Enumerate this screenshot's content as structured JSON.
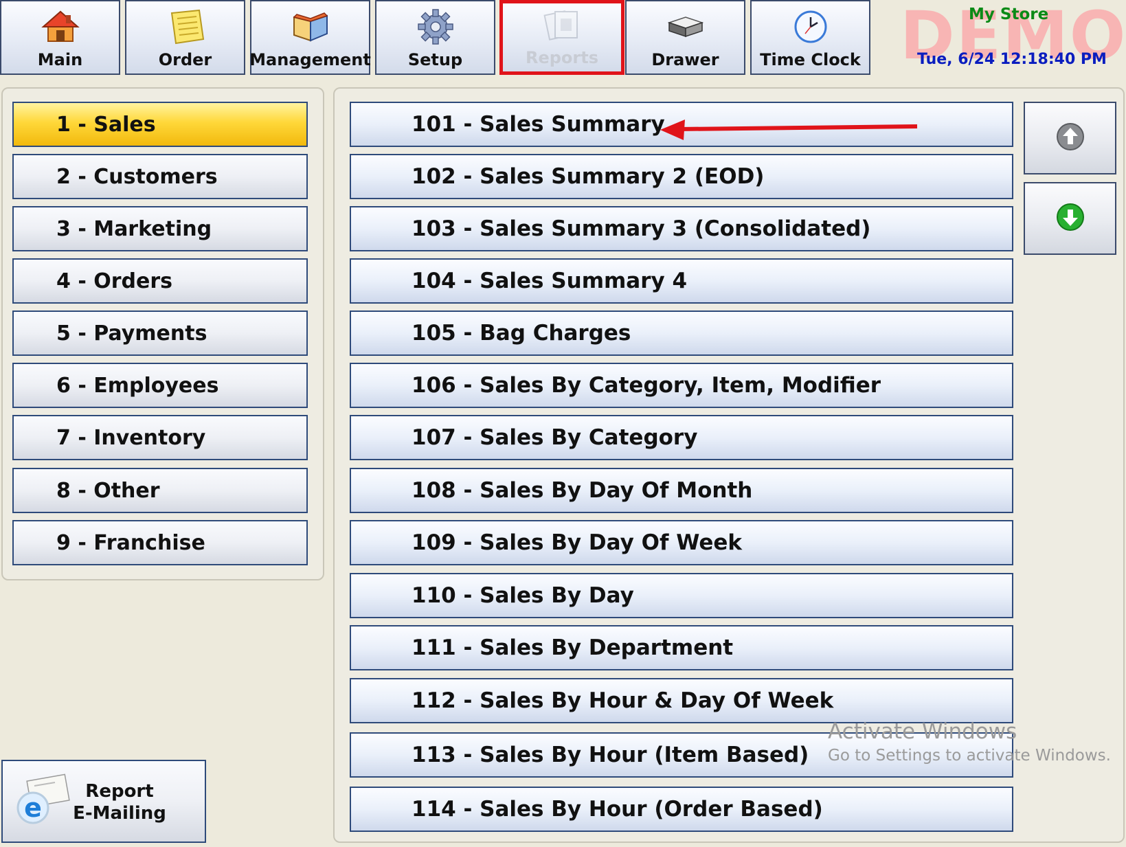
{
  "toolbar": {
    "buttons": [
      {
        "label": "Main",
        "icon": "house-icon"
      },
      {
        "label": "Order",
        "icon": "notepad-icon"
      },
      {
        "label": "Management",
        "icon": "book-icon"
      },
      {
        "label": "Setup",
        "icon": "gear-icon"
      },
      {
        "label": "Reports",
        "icon": "reports-icon",
        "state": "disabled-selected"
      },
      {
        "label": "Drawer",
        "icon": "drawer-icon"
      },
      {
        "label": "Time Clock",
        "icon": "clock-icon"
      }
    ]
  },
  "store": {
    "watermark": "DEMO",
    "name": "My Store",
    "datetime": "Tue, 6/24 12:18:40 PM"
  },
  "categories": [
    {
      "label": "1 - Sales",
      "active": true
    },
    {
      "label": "2 - Customers"
    },
    {
      "label": "3 - Marketing"
    },
    {
      "label": "4 - Orders"
    },
    {
      "label": "5 - Payments"
    },
    {
      "label": "6 - Employees"
    },
    {
      "label": "7 - Inventory"
    },
    {
      "label": "8 - Other"
    },
    {
      "label": "9 - Franchise"
    }
  ],
  "reports": [
    "101 - Sales Summary",
    "102 - Sales Summary 2 (EOD)",
    "103 - Sales Summary 3 (Consolidated)",
    "104 - Sales Summary 4",
    "105 - Bag Charges",
    "106 - Sales By Category, Item, Modifier",
    "107 - Sales By Category",
    "108 - Sales By Day Of Month",
    "109 - Sales By Day Of Week",
    "110 - Sales By Day",
    "111 - Sales By Department",
    "112 - Sales By Hour & Day Of Week",
    "113 - Sales By Hour (Item Based)",
    "114 - Sales By Hour (Order Based)"
  ],
  "email_button": {
    "line1": "Report",
    "line2": "E-Mailing",
    "icon": "ie-email-icon"
  },
  "scroll": {
    "up_icon": "arrow-up-icon",
    "down_icon": "arrow-down-icon"
  },
  "activation": {
    "title": "Activate Windows",
    "subtitle": "Go to Settings to activate Windows."
  },
  "colors": {
    "active_category": "#f2b90d",
    "highlight_box": "#e0141a",
    "annotation_arrow": "#e0141a",
    "store_name": "#0b8a16",
    "datetime": "#0a1dbf",
    "watermark": "#ff9aa0"
  }
}
